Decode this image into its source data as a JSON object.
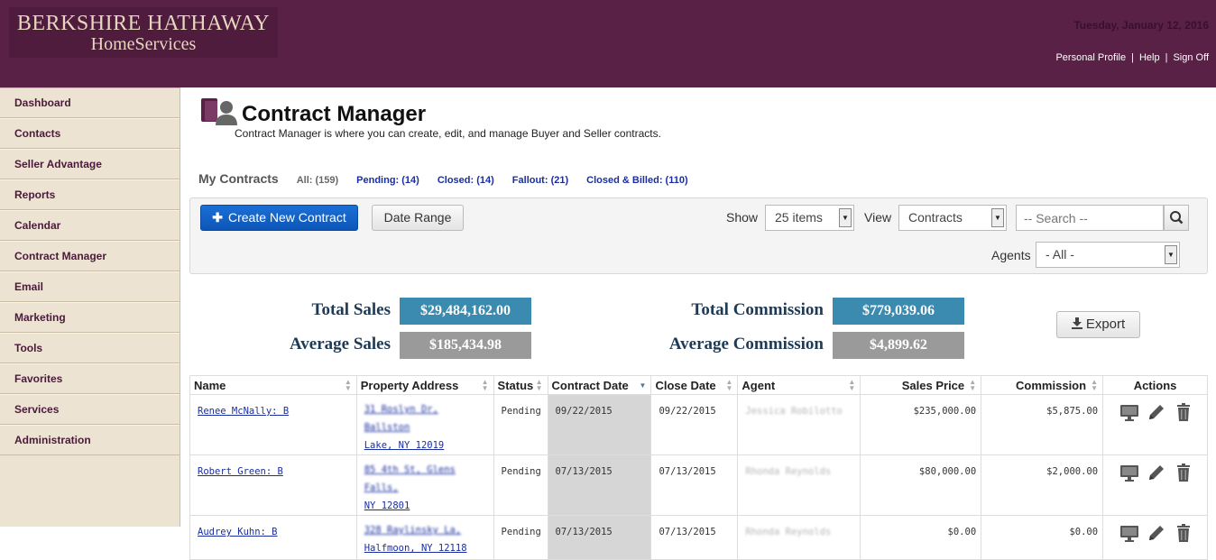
{
  "header": {
    "logo_line1": "BERKSHIRE HATHAWAY",
    "logo_line2": "HomeServices",
    "date": "Tuesday, January 12, 2016",
    "links": [
      "Personal Profile",
      "Help",
      "Sign Off"
    ]
  },
  "sidebar": {
    "items": [
      "Dashboard",
      "Contacts",
      "Seller Advantage",
      "Reports",
      "Calendar",
      "Contract Manager",
      "Email",
      "Marketing",
      "Tools",
      "Favorites",
      "Services",
      "Administration"
    ]
  },
  "page": {
    "title": "Contract Manager",
    "subtitle": "Contract Manager is where you can create, edit, and manage Buyer and Seller contracts."
  },
  "filters": {
    "heading": "My Contracts",
    "all": "All: (159)",
    "pending": "Pending: (14)",
    "closed": "Closed: (14)",
    "fallout": "Fallout: (21)",
    "closed_billed": "Closed & Billed: (110)"
  },
  "toolbar": {
    "create_label": "Create New Contract",
    "date_range_label": "Date Range",
    "show_label": "Show",
    "show_value": "25 items",
    "view_label": "View",
    "view_value": "Contracts",
    "search_placeholder": "-- Search --",
    "agents_label": "Agents",
    "agents_value": "- All -"
  },
  "summary": {
    "total_sales_label": "Total Sales",
    "total_sales": "$29,484,162.00",
    "average_sales_label": "Average Sales",
    "average_sales": "$185,434.98",
    "total_commission_label": "Total Commission",
    "total_commission": "$779,039.06",
    "average_commission_label": "Average Commission",
    "average_commission": "$4,899.62",
    "export_label": "Export"
  },
  "table": {
    "columns": [
      "Name",
      "Property Address",
      "Status",
      "Contract Date",
      "Close Date",
      "Agent",
      "Sales Price",
      "Commission",
      "Actions"
    ],
    "rows": [
      {
        "name": "Renee McNally: B",
        "addr1": "31 Roslyn Dr, Ballston",
        "addr2": "Lake, NY 12019",
        "status": "Pending",
        "contract_date": "09/22/2015",
        "close_date": "09/22/2015",
        "agent": "Jessica Robilotto",
        "price": "$235,000.00",
        "commission": "$5,875.00"
      },
      {
        "name": "Robert Green: B",
        "addr1": "85 4th St, Glens Falls,",
        "addr2": "NY 12801",
        "status": "Pending",
        "contract_date": "07/13/2015",
        "close_date": "07/13/2015",
        "agent": "Rhonda Reynolds",
        "price": "$80,000.00",
        "commission": "$2,000.00"
      },
      {
        "name": "Audrey Kuhn: B",
        "addr1": "328 Raylinsky La,",
        "addr2": "Halfmoon, NY 12118",
        "status": "Pending",
        "contract_date": "07/13/2015",
        "close_date": "07/13/2015",
        "agent": "Rhonda Reynolds",
        "price": "$0.00",
        "commission": "$0.00"
      }
    ]
  },
  "colors": {
    "header_bg": "#5a2147",
    "sidebar_bg": "#ede3d2",
    "primary_button": "#0d56b8",
    "total_badge": "#3b8bb0",
    "average_badge": "#9a9a9a"
  }
}
